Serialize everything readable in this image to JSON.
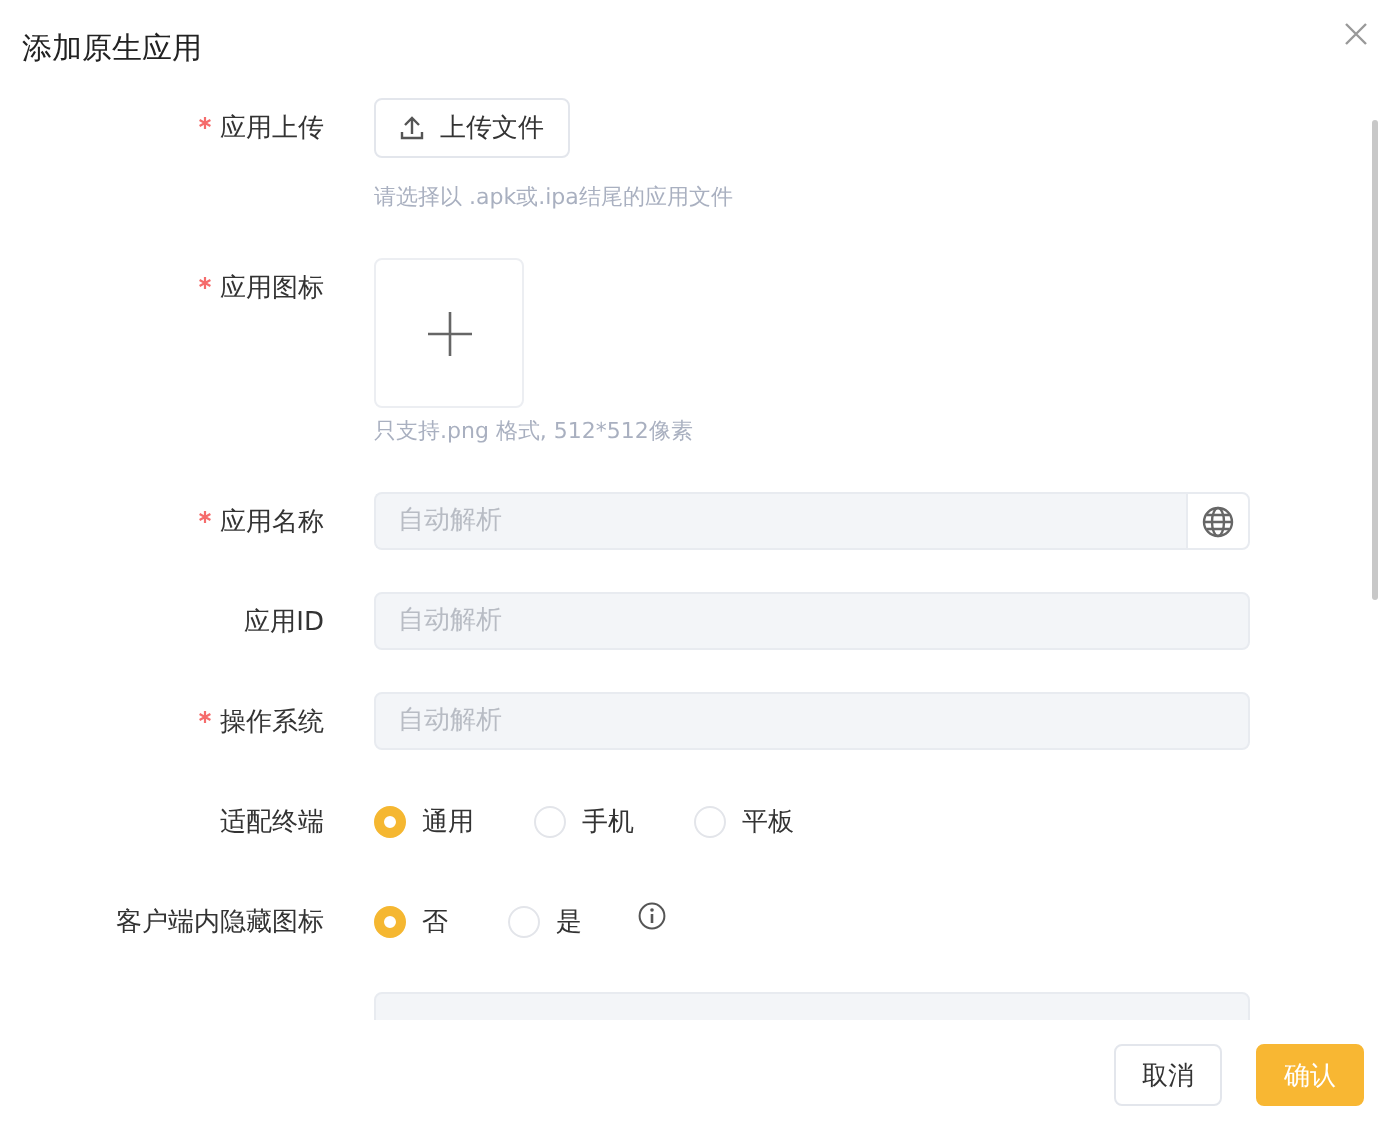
{
  "dialog": {
    "title": "添加原生应用"
  },
  "fields": [
    {
      "kind": "upload",
      "label": "应用上传",
      "required": true,
      "button": "上传文件",
      "hint": "请选择以 .apk或.ipa结尾的应用文件"
    },
    {
      "kind": "image",
      "label": "应用图标",
      "required": true,
      "hint": "只支持.png 格式, 512*512像素"
    },
    {
      "kind": "input",
      "label": "应用名称",
      "required": true,
      "placeholder": "自动解析",
      "globe": true
    },
    {
      "kind": "input",
      "label": "应用ID",
      "required": false,
      "placeholder": "自动解析",
      "globe": false
    },
    {
      "kind": "input",
      "label": "操作系统",
      "required": true,
      "placeholder": "自动解析",
      "globe": false
    },
    {
      "kind": "radio",
      "label": "适配终端",
      "required": false,
      "info": false,
      "options": [
        {
          "label": "通用",
          "selected": true
        },
        {
          "label": "手机",
          "selected": false
        },
        {
          "label": "平板",
          "selected": false
        }
      ]
    },
    {
      "kind": "radio",
      "label": "客户端内隐藏图标",
      "required": false,
      "info": true,
      "options": [
        {
          "label": "否",
          "selected": true
        },
        {
          "label": "是",
          "selected": false
        }
      ]
    },
    {
      "kind": "input",
      "required": false,
      "globe": false
    }
  ],
  "buttons": [
    {
      "label": "取消",
      "kind": "secondary"
    },
    {
      "label": "确认",
      "kind": "primary"
    }
  ]
}
